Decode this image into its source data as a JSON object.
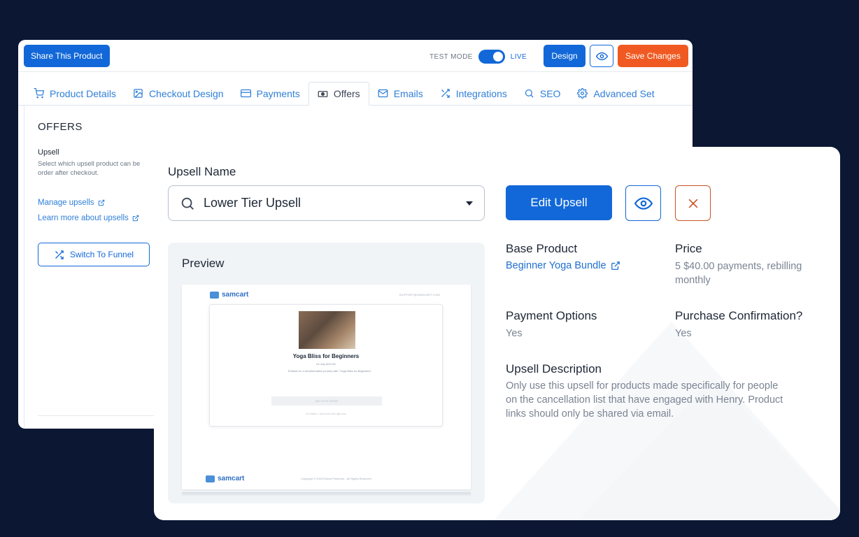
{
  "back_window": {
    "share_button": "Share This Product",
    "test_mode_label": "TEST MODE",
    "live_label": "LIVE",
    "design_button": "Design",
    "save_button": "Save Changes",
    "tabs": [
      {
        "label": "Product Details",
        "icon": "cart-icon"
      },
      {
        "label": "Checkout Design",
        "icon": "image-icon"
      },
      {
        "label": "Payments",
        "icon": "card-icon"
      },
      {
        "label": "Offers",
        "icon": "money-icon"
      },
      {
        "label": "Emails",
        "icon": "mail-icon"
      },
      {
        "label": "Integrations",
        "icon": "shuffle-icon"
      },
      {
        "label": "SEO",
        "icon": "search-icon"
      },
      {
        "label": "Advanced Set",
        "icon": "gear-icon"
      }
    ],
    "active_tab": "Offers",
    "offers_title": "OFFERS",
    "upsell_label": "Upsell",
    "upsell_description": "Select which upsell product can be order after checkout.",
    "manage_upsells_link": "Manage upsells",
    "learn_more_link": "Learn more about upsells",
    "switch_funnel_button": "Switch To Funnel"
  },
  "front_card": {
    "upsell_name_label": "Upsell Name",
    "upsell_select_value": "Lower Tier Upsell",
    "edit_button": "Edit Upsell",
    "preview_title": "Preview",
    "preview": {
      "logo_text": "samcart",
      "support_text": "SUPPORT@SAMCART.COM",
      "product_name": "Yoga Bliss for Beginners",
      "price_text": "for only $24.00!",
      "body_text": "Embark on a transformative journey with \"Yoga Bliss for Beginners\"",
      "cta_text": "ADD TO MY ORDER",
      "decline_text": "No thanks, I don't need this right now",
      "footer_text": "Copyright © 2023 Robert Pinkerton - All Rights Reserved"
    },
    "base_product": {
      "label": "Base Product",
      "value": "Beginner Yoga Bundle"
    },
    "price": {
      "label": "Price",
      "value_line1": "5 $40.00 payments, rebilling",
      "value_line2": "monthly"
    },
    "payment_options": {
      "label": "Payment Options",
      "value": "Yes"
    },
    "purchase_confirmation": {
      "label": "Purchase Confirmation?",
      "value": "Yes"
    },
    "upsell_description": {
      "label": "Upsell Description",
      "line1": "Only use this upsell for products made specifically for people",
      "line2": "on the cancellation list that have engaged with Henry. Product",
      "line3": "links should only be shared via email."
    }
  },
  "colors": {
    "background": "#0b1733",
    "primary_blue": "#1268d8",
    "save_orange": "#f05a22",
    "delete_red": "#c8542a"
  }
}
